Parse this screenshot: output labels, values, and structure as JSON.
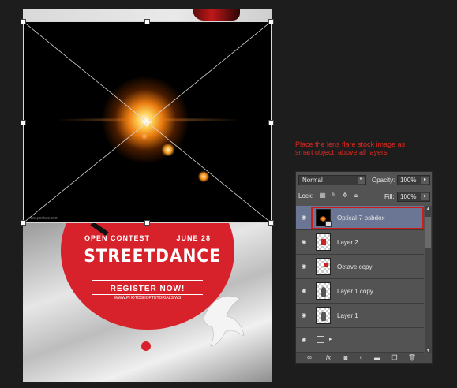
{
  "annotation": {
    "line1": "Place the lens flare stock image as",
    "line2": "smart object, above all layers"
  },
  "poster": {
    "flare_watermark": "www.psdtuts.com",
    "contest_left": "OPEN CONTEST",
    "contest_right": "JUNE 28",
    "title": "STREETDANCE",
    "cta": "REGISTER NOW!",
    "url": "WWW.PHOTOSHOPTUTORIALS.WS"
  },
  "layers_panel": {
    "blend_mode": "Normal",
    "opacity_label": "Opacity:",
    "opacity_value": "100%",
    "lock_label": "Lock:",
    "fill_label": "Fill:",
    "fill_value": "100%",
    "layers": [
      {
        "name": "Optical-7-psbdox",
        "selected": true
      },
      {
        "name": "Layer 2"
      },
      {
        "name": "Octave copy"
      },
      {
        "name": "Layer 1 copy"
      },
      {
        "name": "Layer 1"
      }
    ]
  },
  "colors": {
    "annotation_red": "#e0281f",
    "poster_red": "#d8222b",
    "panel_bg": "#535353",
    "selected_row": "#6b7694"
  }
}
